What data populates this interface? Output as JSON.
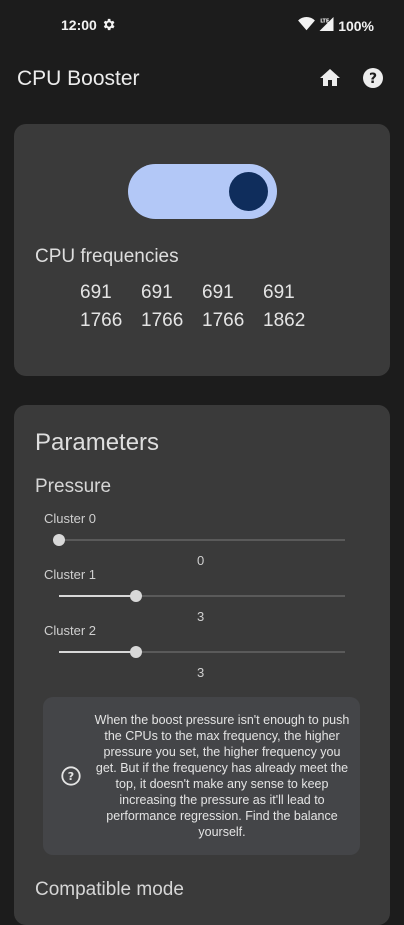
{
  "status_bar": {
    "time": "12:00",
    "battery": "100%",
    "gear_icon": "gear-icon",
    "wifi_icon": "wifi-icon",
    "signal_icon": "signal-icon",
    "battery_icon": "battery-icon"
  },
  "app_bar": {
    "title": "CPU Booster",
    "home_icon": "home-icon",
    "help_icon": "help-icon"
  },
  "booster": {
    "enabled": true,
    "toggle_color": "#b3c8f7",
    "knob_color": "#0f2d5c"
  },
  "cpu": {
    "title": "CPU frequencies",
    "min_freqs": [
      "691",
      "691",
      "691",
      "691"
    ],
    "max_freqs": [
      "1766",
      "1766",
      "1766",
      "1862"
    ]
  },
  "parameters": {
    "title": "Parameters",
    "pressure_title": "Pressure",
    "clusters": [
      {
        "label": "Cluster 0",
        "value": "0",
        "fraction": 0.0
      },
      {
        "label": "Cluster 1",
        "value": "3",
        "fraction": 0.27
      },
      {
        "label": "Cluster 2",
        "value": "3",
        "fraction": 0.27
      }
    ],
    "info_text": "When the boost pressure isn't enough to push the CPUs to the max frequency, the higher pressure you set, the higher frequency you get. But if the frequency has already meet the top, it doesn't make any sense to keep increasing the pressure as it'll lead to performance regression. Find the balance yourself.",
    "compat_title": "Compatible mode"
  }
}
